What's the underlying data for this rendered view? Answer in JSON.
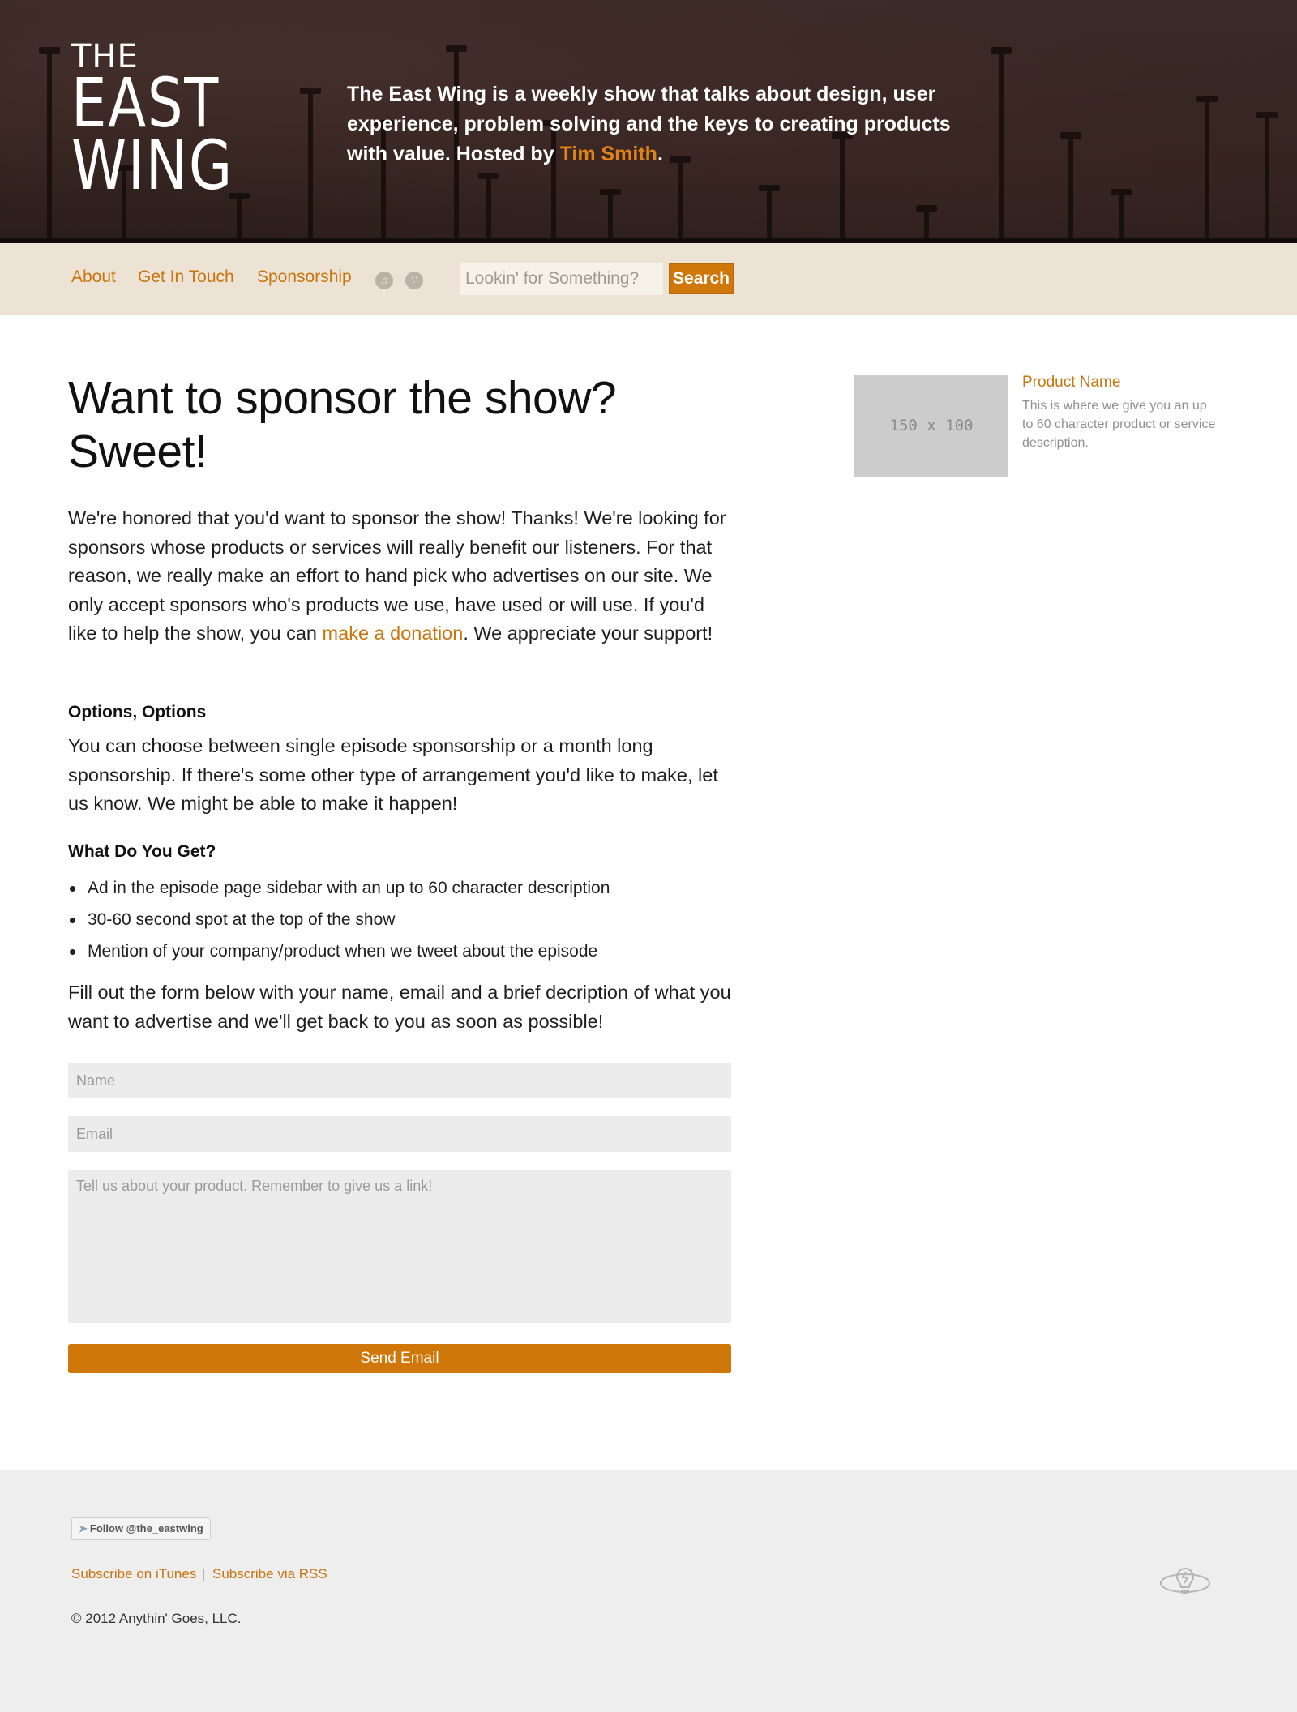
{
  "header": {
    "logo": {
      "line1": "THE",
      "line2": "EAST",
      "line3": "WING"
    },
    "tagline_before": "The East Wing is a weekly show that talks about design, user experience, problem solving and the keys to creating products with value. Hosted by ",
    "host_name": "Tim Smith",
    "tagline_after": "."
  },
  "nav": {
    "links": [
      "About",
      "Get In Touch",
      "Sponsorship"
    ],
    "icons": [
      "itunes-icon",
      "rss-icon"
    ],
    "search_placeholder": "Lookin' for Something?",
    "search_button": "Search"
  },
  "main": {
    "title_line1": "Want to sponsor the show?",
    "title_line2": "Sweet!",
    "intro_before": "We're honored that you'd want to sponsor the show! Thanks! We're looking for sponsors whose products or services will really benefit our listeners. For that reason, we really make an effort to hand pick who advertises on our site. We only accept sponsors who's products we use, have used or will use. If you'd like to help the show, you can ",
    "donation_link": "make a donation",
    "intro_after": ". We appreciate your support!",
    "options_heading": "Options, Options",
    "options_text": "You can choose between single episode sponsorship or a month long sponsorship. If there's some other type of arrangement you'd like to make, let us know. We might be able to make it happen!",
    "get_heading": "What Do You Get?",
    "benefits": [
      "Ad in the episode page sidebar with an up to 60 character description",
      "30-60 second spot at the top of the show",
      "Mention of your company/product when we tweet about the episode"
    ],
    "form_intro": "Fill out the form below with your name, email and a brief decription of what you want to advertise and we'll get back to you as soon as possible!",
    "form": {
      "name_placeholder": "Name",
      "email_placeholder": "Email",
      "message_placeholder": "Tell us about your product. Remember to give us a link!",
      "submit_label": "Send Email"
    }
  },
  "sidebar": {
    "ad_image_text": "150 x 100",
    "product_name": "Product Name",
    "product_description": "This is where we give you an up to 60 character product or service description."
  },
  "footer": {
    "follow_label": "Follow @the_eastwing",
    "subscribe_itunes": "Subscribe on iTunes",
    "separator": "|",
    "subscribe_rss": "Subscribe via RSS",
    "copyright": "© 2012 Anythin' Goes, LLC."
  },
  "colors": {
    "accent": "#cf7708",
    "link": "#c8740f",
    "header_bg": "#33231f",
    "nav_bg": "#ede3d4",
    "footer_bg": "#eeeeee"
  }
}
